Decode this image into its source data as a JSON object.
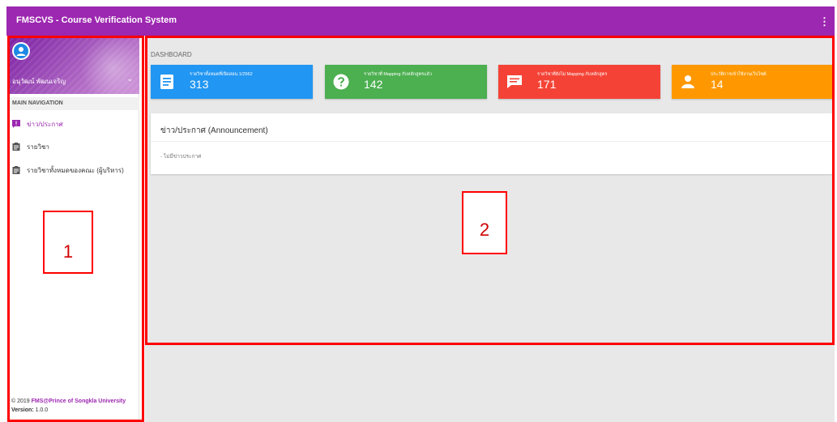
{
  "app": {
    "title": "FMSCVS - Course Verification System",
    "menu_glyph": "⋮"
  },
  "user": {
    "name": "อนุวัฒน์ พัฒนเจริญ"
  },
  "sidebar": {
    "nav_header": "MAIN NAVIGATION",
    "items": [
      {
        "label": "ข่าว/ประกาศ",
        "icon": "announcement-icon",
        "active": true
      },
      {
        "label": "รายวิชา",
        "icon": "clipboard-icon",
        "active": false
      },
      {
        "label": "รายวิชาทั้งหมดของคณะ (ผู้บริหาร)",
        "icon": "clipboard-icon",
        "active": false
      }
    ],
    "footer": {
      "copyright": "© 2019 ",
      "org": "FMS@Prince of Songkla University",
      "version_label": "Version:",
      "version": "1.0.0"
    }
  },
  "main": {
    "breadcrumb": "DASHBOARD",
    "cards": [
      {
        "label": "รายวิชาทั้งหมดที่เปิดสอน 1/2562",
        "value": "313",
        "color": "#2196f3",
        "icon": "book-icon"
      },
      {
        "label": "รายวิชาที่ Mapping กับหลักสูตรแล้ว",
        "value": "142",
        "color": "#4caf50",
        "icon": "help-icon"
      },
      {
        "label": "รายวิชาที่ยังไม่ Mapping กับหลักสูตร",
        "value": "171",
        "color": "#f44336",
        "icon": "chat-icon"
      },
      {
        "label": "ประวัติการเข้าใช้งานเว็บไซต์",
        "value": "14",
        "color": "#ff9800",
        "icon": "person-icon"
      }
    ],
    "announcement": {
      "title": "ข่าว/ประกาศ (Announcement)",
      "empty_text": "- ไม่มีข่าวประกาศ"
    }
  },
  "annotations": {
    "label_1": "1",
    "label_2": "2"
  }
}
